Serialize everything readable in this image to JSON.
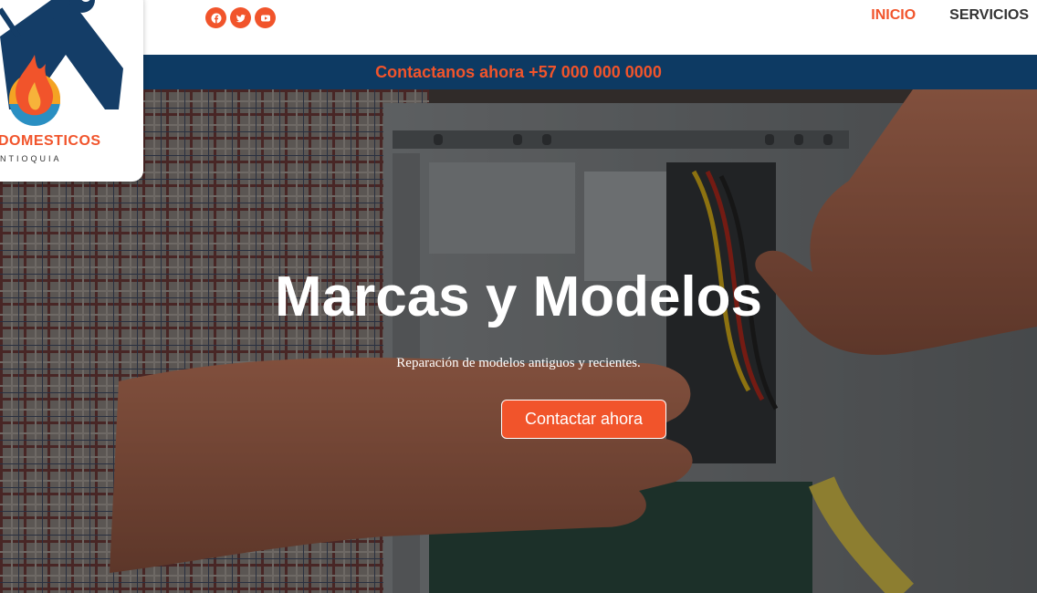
{
  "header": {
    "social_icons": [
      "facebook-icon",
      "twitter-icon",
      "youtube-icon"
    ],
    "nav": [
      {
        "label": "INICIO",
        "active": true
      },
      {
        "label": "SERVICIOS",
        "active": false
      }
    ]
  },
  "contact_bar": {
    "text": "Contactanos ahora +57 000 000 0000"
  },
  "logo": {
    "name": "DOMESTICOS",
    "subtitle": "NTIOQUIA"
  },
  "hero": {
    "title": "Marcas y Modelos",
    "subtitle": "Reparación de modelos antiguos y recientes.",
    "button_label": "Contactar ahora"
  },
  "colors": {
    "accent": "#f1542b",
    "navy": "#0d3a63",
    "white": "#ffffff"
  }
}
